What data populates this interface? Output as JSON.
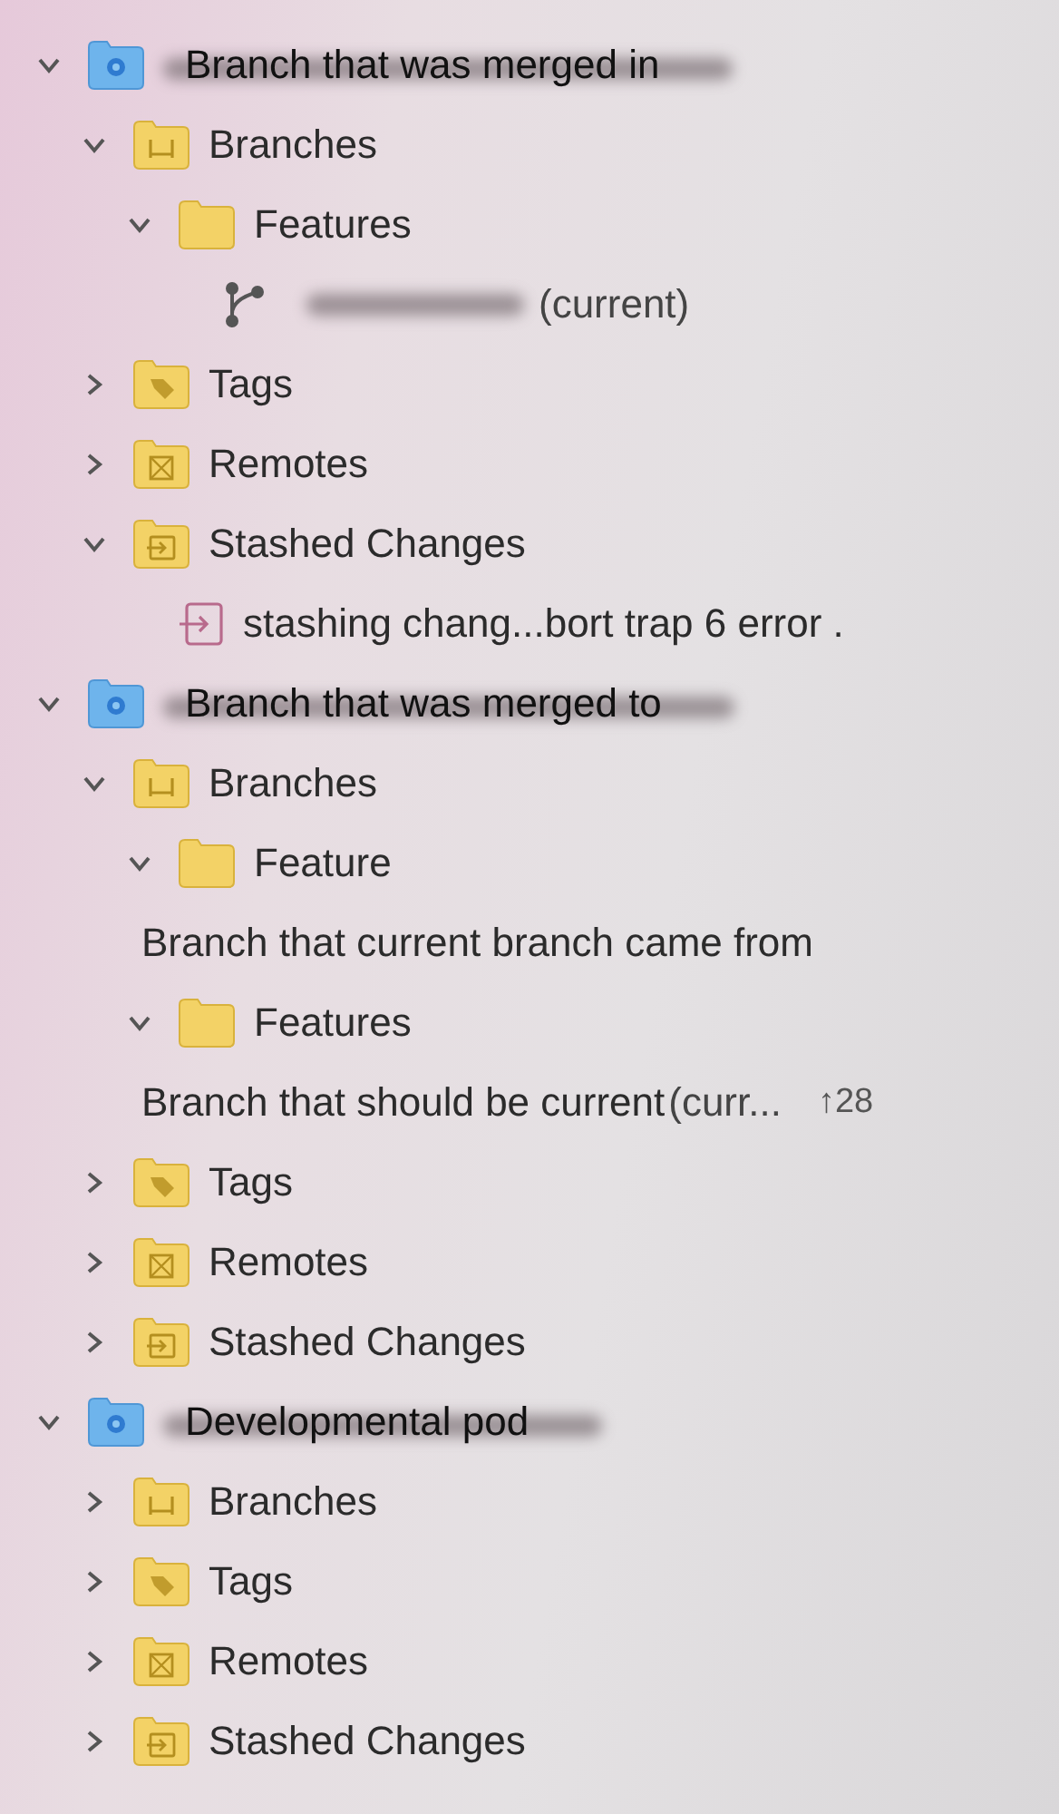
{
  "tree": [
    {
      "kind": "repo",
      "label": "Branch that was merged in",
      "redacted": true,
      "expanded": true,
      "children": [
        {
          "kind": "branches",
          "label": "Branches",
          "expanded": true,
          "children": [
            {
              "kind": "folder",
              "label": "Features",
              "expanded": true,
              "children": [
                {
                  "kind": "branch",
                  "redacted": true,
                  "suffix": "(current)"
                }
              ]
            }
          ]
        },
        {
          "kind": "tags",
          "label": "Tags",
          "expanded": false
        },
        {
          "kind": "remotes",
          "label": "Remotes",
          "expanded": false
        },
        {
          "kind": "stashes",
          "label": "Stashed Changes",
          "expanded": true,
          "children": [
            {
              "kind": "stash",
              "label": "stashing chang...bort trap 6 error ."
            }
          ]
        }
      ]
    },
    {
      "kind": "repo",
      "label": "Branch that was merged to",
      "redacted": true,
      "expanded": true,
      "children": [
        {
          "kind": "branches",
          "label": "Branches",
          "expanded": true,
          "children": [
            {
              "kind": "folder",
              "label": "Feature",
              "expanded": true,
              "children": [
                {
                  "kind": "annotation",
                  "label": "Branch that current branch came from"
                }
              ]
            },
            {
              "kind": "folder",
              "label": "Features",
              "expanded": true,
              "children": [
                {
                  "kind": "annotation",
                  "label": "Branch that should be current",
                  "suffix": "(curr...",
                  "badge": "↑28"
                }
              ]
            }
          ]
        },
        {
          "kind": "tags",
          "label": "Tags",
          "expanded": false
        },
        {
          "kind": "remotes",
          "label": "Remotes",
          "expanded": false
        },
        {
          "kind": "stashes",
          "label": "Stashed Changes",
          "expanded": false
        }
      ]
    },
    {
      "kind": "repo",
      "label": "Developmental pod",
      "redacted": true,
      "expanded": true,
      "children": [
        {
          "kind": "branches",
          "label": "Branches",
          "expanded": false
        },
        {
          "kind": "tags",
          "label": "Tags",
          "expanded": false
        },
        {
          "kind": "remotes",
          "label": "Remotes",
          "expanded": false
        },
        {
          "kind": "stashes",
          "label": "Stashed Changes",
          "expanded": false
        }
      ]
    }
  ]
}
